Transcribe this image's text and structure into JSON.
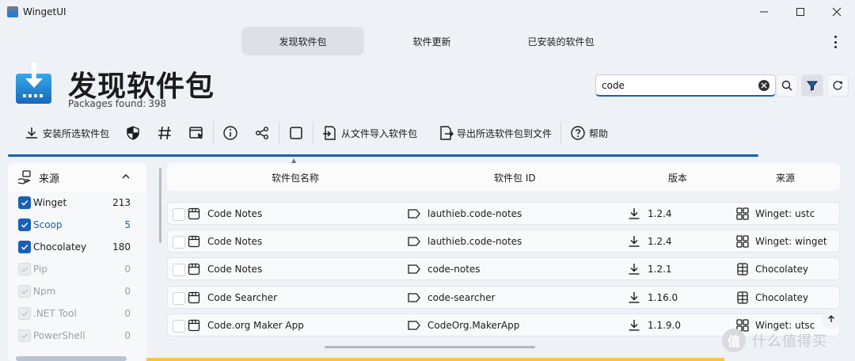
{
  "window": {
    "title": "WingetUI"
  },
  "nav": {
    "tabs": [
      {
        "label": "发现软件包"
      },
      {
        "label": "软件更新"
      },
      {
        "label": "已安装的软件包"
      }
    ]
  },
  "header": {
    "title": "发现软件包",
    "found_label": "Packages found:",
    "found_count": "398"
  },
  "search": {
    "value": "code"
  },
  "toolbar": {
    "install_label": "安装所选软件包",
    "import_label": "从文件导入软件包",
    "export_label": "导出所选软件包到文件",
    "help_label": "帮助"
  },
  "sidebar": {
    "title": "来源",
    "items": [
      {
        "name": "Winget",
        "count": "213",
        "checked": true
      },
      {
        "name": "Scoop",
        "count": "5",
        "checked": true
      },
      {
        "name": "Chocolatey",
        "count": "180",
        "checked": true
      },
      {
        "name": "Pip",
        "count": "0",
        "checked": false
      },
      {
        "name": "Npm",
        "count": "0",
        "checked": false
      },
      {
        "name": ".NET Tool",
        "count": "0",
        "checked": false
      },
      {
        "name": "PowerShell",
        "count": "0",
        "checked": false
      }
    ]
  },
  "table": {
    "columns": {
      "name": "软件包名称",
      "id": "软件包 ID",
      "version": "版本",
      "source": "来源"
    },
    "rows": [
      {
        "name": "Code Notes",
        "id": "lauthieb.code-notes",
        "version": "1.2.4",
        "source": "Winget: ustc",
        "source_icon": "winget-icon"
      },
      {
        "name": "Code Notes",
        "id": "lauthieb.code-notes",
        "version": "1.2.4",
        "source": "Winget: winget",
        "source_icon": "winget-icon"
      },
      {
        "name": "Code Notes",
        "id": "code-notes",
        "version": "1.2.1",
        "source": "Chocolatey",
        "source_icon": "chocolatey-icon"
      },
      {
        "name": "Code Searcher",
        "id": "code-searcher",
        "version": "1.16.0",
        "source": "Chocolatey",
        "source_icon": "chocolatey-icon"
      },
      {
        "name": "Code.org Maker App",
        "id": "CodeOrg.MakerApp",
        "version": "1.1.9.0",
        "source": "Winget: utsc",
        "source_icon": "winget-icon"
      }
    ]
  },
  "watermark": {
    "text": "什么值得买",
    "logo": "值"
  },
  "colors": {
    "accent": "#1a5fb4",
    "background": "#eef1f6",
    "strip": "#f4c542"
  }
}
